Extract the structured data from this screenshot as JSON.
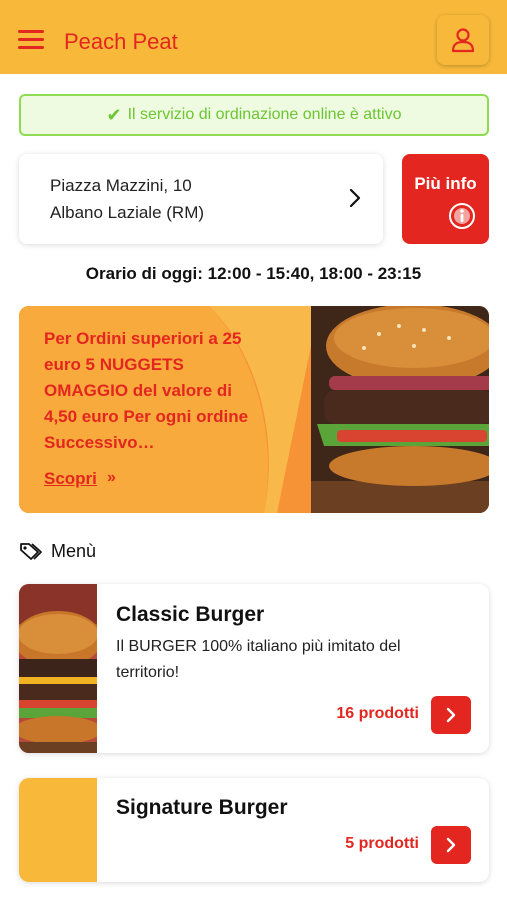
{
  "header": {
    "brand": "Peach Peat",
    "menu_icon": "hamburger-menu-icon",
    "user_icon": "user-icon",
    "background_color": "#f8b93b",
    "accent_color": "#e3261f"
  },
  "status": {
    "text": "Il servizio di ordinazione online è attivo",
    "icon": "check-icon",
    "color": "#6cc532"
  },
  "address": {
    "line1": "Piazza Mazzini, 10",
    "line2": "Albano Laziale (RM)",
    "icon": "chevron-right-icon"
  },
  "info_button": {
    "label": "Più info",
    "icon": "info-icon"
  },
  "hours": {
    "text": "Orario di oggi: 12:00 - 15:40, 18:00 - 23:15"
  },
  "promo": {
    "text": "Per Ordini superiori a 25 euro 5 NUGGETS OMAGGIO del valore di 4,50 euro Per ogni ordine Successivo…",
    "link_label": "Scopri",
    "link_icon": "double-chevron-right-icon"
  },
  "menu": {
    "title": "Menù",
    "icon": "tags-icon",
    "categories": [
      {
        "title": "Classic Burger",
        "description": "Il BURGER 100% italiano più imitato del territorio!",
        "count": "16 prodotti"
      },
      {
        "title": "Signature Burger",
        "count": "5 prodotti"
      }
    ]
  }
}
